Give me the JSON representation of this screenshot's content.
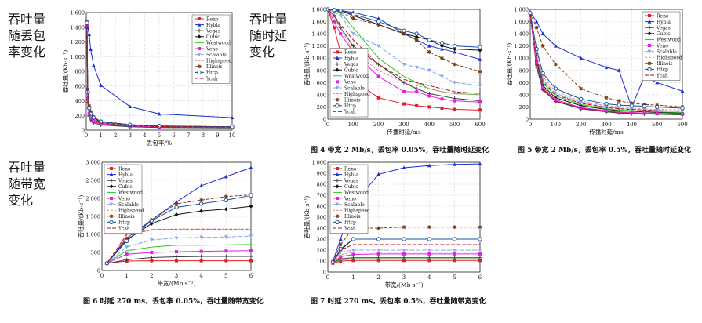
{
  "side_labels": [
    "吞吐量\n随丢包\n率变化",
    "吞吐量\n随时延\n变化",
    "吞吐量\n随带宽\n变化"
  ],
  "captions": {
    "fig4": "图 4  带宽 2 Mb/s，丢包率 0.05%，吞吐量随时延变化",
    "fig5": "图 5  带宽 2 Mb/s，丢包率 0.5%，吞吐量随时延变化",
    "fig6": "图 6  时延 270 ms，丢包率 0.05%，吞吐量随带宽变化",
    "fig7": "图 7  时延 270 ms，丢包率 0.5%，吞吐量随带宽变化"
  },
  "colors": {
    "Reno": "#e0202a",
    "Hybla": "#1c2fd6",
    "Vegas": "#3a3a3a",
    "Cubic": "#111111",
    "Westwood": "#22cc22",
    "Veno": "#e020e0",
    "Scalable": "#8aa7ee",
    "Highspeed": "#e08a8a",
    "Illinois": "#7a3a10",
    "Htcp": "#1a4fa0",
    "Ycah": "#b01010"
  },
  "chart_data": [
    {
      "type": "line",
      "xlabel": "丢包率/%",
      "ylabel": "吞吐量/(Kb·s⁻¹)",
      "x": [
        0.05,
        0.1,
        0.2,
        0.3,
        0.5,
        1,
        3,
        5,
        10
      ],
      "xticks": [
        "0",
        "1",
        "2",
        "3",
        "4",
        "5",
        "6",
        "7",
        "8",
        "9",
        "10"
      ],
      "yticks": [
        "0",
        "200",
        "400",
        "600",
        "800",
        "1 000",
        "1 200",
        "1 400",
        "1 600"
      ],
      "xlim": [
        0,
        10
      ],
      "ylim": [
        0,
        1600
      ],
      "legend": "top-right",
      "series": [
        {
          "name": "Reno",
          "values": [
            1400,
            420,
            210,
            160,
            120,
            80,
            50,
            40,
            35
          ]
        },
        {
          "name": "Hybla",
          "values": [
            1480,
            1400,
            1300,
            1100,
            880,
            610,
            320,
            220,
            170
          ]
        },
        {
          "name": "Vegas",
          "values": [
            1450,
            380,
            190,
            140,
            100,
            70,
            45,
            35,
            30
          ]
        },
        {
          "name": "Cubic",
          "values": [
            1460,
            520,
            300,
            220,
            160,
            110,
            70,
            55,
            45
          ]
        },
        {
          "name": "Westwood",
          "values": [
            1430,
            440,
            230,
            170,
            130,
            90,
            60,
            45,
            40
          ]
        },
        {
          "name": "Veno",
          "values": [
            1420,
            430,
            220,
            160,
            120,
            85,
            55,
            42,
            38
          ]
        },
        {
          "name": "Scalable",
          "values": [
            1440,
            480,
            260,
            200,
            150,
            100,
            65,
            50,
            42
          ]
        },
        {
          "name": "Highspeed",
          "values": [
            1450,
            500,
            280,
            210,
            160,
            105,
            70,
            52,
            44
          ]
        },
        {
          "name": "Illinois",
          "values": [
            1470,
            560,
            330,
            250,
            180,
            120,
            75,
            58,
            46
          ]
        },
        {
          "name": "Htcp",
          "values": [
            1460,
            520,
            300,
            220,
            170,
            115,
            72,
            56,
            45
          ]
        },
        {
          "name": "Ycah",
          "values": [
            1440,
            470,
            250,
            190,
            145,
            98,
            62,
            48,
            41
          ]
        }
      ]
    },
    {
      "type": "line",
      "xlabel": "传播时延/ms",
      "ylabel": "吞吐量/(Kb·s⁻¹)",
      "x": [
        0,
        25,
        50,
        100,
        200,
        300,
        350,
        400,
        450,
        500,
        600
      ],
      "xticks": [
        "0",
        "100",
        "200",
        "300",
        "400",
        "500",
        "600"
      ],
      "yticks": [
        "0",
        "200",
        "400",
        "600",
        "800",
        "1 000",
        "1 200",
        "1 400",
        "1 600",
        "1 800"
      ],
      "xlim": [
        0,
        600
      ],
      "ylim": [
        0,
        1800
      ],
      "legend": "bottom-left",
      "series": [
        {
          "name": "Reno",
          "values": [
            1800,
            1500,
            1100,
            650,
            350,
            250,
            220,
            200,
            180,
            160,
            150
          ]
        },
        {
          "name": "Hybla",
          "values": [
            1800,
            1790,
            1780,
            1750,
            1650,
            1400,
            1300,
            1200,
            1150,
            1100,
            980
          ]
        },
        {
          "name": "Vegas",
          "values": [
            1800,
            1700,
            1500,
            1200,
            900,
            600,
            500,
            420,
            380,
            340,
            300
          ]
        },
        {
          "name": "Cubic",
          "values": [
            1800,
            1790,
            1780,
            1700,
            1550,
            1400,
            1350,
            1300,
            1200,
            1150,
            1130
          ]
        },
        {
          "name": "Westwood",
          "values": [
            1800,
            1780,
            1750,
            1500,
            1000,
            700,
            600,
            500,
            450,
            420,
            400
          ]
        },
        {
          "name": "Veno",
          "values": [
            1800,
            1600,
            1400,
            1100,
            700,
            450,
            450,
            380,
            330,
            300,
            280
          ]
        },
        {
          "name": "Scalable",
          "values": [
            1800,
            1750,
            1700,
            1400,
            1200,
            900,
            850,
            800,
            700,
            600,
            550
          ]
        },
        {
          "name": "Highspeed",
          "values": [
            1800,
            1650,
            1500,
            1100,
            800,
            600,
            550,
            500,
            450,
            420,
            400
          ]
        },
        {
          "name": "Illinois",
          "values": [
            1800,
            1780,
            1760,
            1650,
            1550,
            1400,
            1300,
            1100,
            1000,
            900,
            780
          ]
        },
        {
          "name": "Htcp",
          "values": [
            1800,
            1790,
            1780,
            1720,
            1600,
            1450,
            1400,
            1300,
            1250,
            1200,
            1180
          ]
        },
        {
          "name": "Ycah",
          "values": [
            1800,
            1700,
            1550,
            1300,
            900,
            650,
            600,
            550,
            500,
            450,
            420
          ]
        }
      ]
    },
    {
      "type": "line",
      "xlabel": "传播时延/ms",
      "ylabel": "吞吐量/(Kb·s⁻¹)",
      "x": [
        0,
        25,
        50,
        100,
        200,
        300,
        350,
        400,
        450,
        500,
        600
      ],
      "xticks": [
        "0",
        "100",
        "200",
        "300",
        "400",
        "500",
        "600"
      ],
      "yticks": [
        "0",
        "200",
        "400",
        "600",
        "800",
        "1 000",
        "1 200",
        "1 400",
        "1 600",
        "1 800"
      ],
      "xlim": [
        0,
        600
      ],
      "ylim": [
        0,
        1800
      ],
      "legend": "top-right",
      "series": [
        {
          "name": "Reno",
          "values": [
            1700,
            900,
            500,
            300,
            180,
            130,
            110,
            100,
            95,
            90,
            80
          ]
        },
        {
          "name": "Hybla",
          "values": [
            1750,
            1600,
            1400,
            1200,
            1000,
            850,
            800,
            200,
            700,
            600,
            460
          ]
        },
        {
          "name": "Vegas",
          "values": [
            1720,
            850,
            480,
            290,
            170,
            120,
            100,
            90,
            85,
            80,
            70
          ]
        },
        {
          "name": "Cubic",
          "values": [
            1730,
            950,
            550,
            350,
            220,
            160,
            140,
            130,
            120,
            110,
            100
          ]
        },
        {
          "name": "Westwood",
          "values": [
            1710,
            1000,
            600,
            380,
            240,
            170,
            150,
            140,
            130,
            120,
            110
          ]
        },
        {
          "name": "Veno",
          "values": [
            1700,
            920,
            520,
            320,
            190,
            140,
            120,
            110,
            100,
            95,
            85
          ]
        },
        {
          "name": "Scalable",
          "values": [
            1720,
            1050,
            650,
            420,
            280,
            200,
            180,
            160,
            150,
            140,
            130
          ]
        },
        {
          "name": "Highspeed",
          "values": [
            1730,
            1100,
            700,
            450,
            300,
            220,
            200,
            180,
            170,
            160,
            150
          ]
        },
        {
          "name": "Illinois",
          "values": [
            1740,
            1500,
            1200,
            900,
            500,
            350,
            300,
            260,
            240,
            230,
            200
          ]
        },
        {
          "name": "Htcp",
          "values": [
            1740,
            1150,
            750,
            500,
            330,
            250,
            230,
            220,
            210,
            200,
            180
          ]
        },
        {
          "name": "Ycah",
          "values": [
            1720,
            1000,
            620,
            400,
            260,
            190,
            170,
            160,
            150,
            140,
            130
          ]
        }
      ]
    },
    {
      "type": "line",
      "xlabel": "带宽/(Mb·s⁻¹)",
      "ylabel": "吞吐量/(Kb·s⁻¹)",
      "x": [
        0.2,
        1,
        2,
        3,
        4,
        5,
        6
      ],
      "xticks": [
        "0",
        "1",
        "2",
        "3",
        "4",
        "5",
        "6"
      ],
      "yticks": [
        "0",
        "500",
        "1 000",
        "1 500",
        "2 000",
        "2 500",
        "3 000"
      ],
      "xlim": [
        0,
        6
      ],
      "ylim": [
        0,
        3000
      ],
      "legend": "top-left",
      "series": [
        {
          "name": "Reno",
          "values": [
            200,
            260,
            270,
            270,
            270,
            270,
            270
          ]
        },
        {
          "name": "Hybla",
          "values": [
            200,
            900,
            1400,
            1900,
            2350,
            2600,
            2850
          ]
        },
        {
          "name": "Vegas",
          "values": [
            190,
            300,
            360,
            380,
            390,
            390,
            390
          ]
        },
        {
          "name": "Cubic",
          "values": [
            200,
            850,
            1300,
            1550,
            1650,
            1700,
            1780
          ]
        },
        {
          "name": "Westwood",
          "values": [
            200,
            550,
            650,
            700,
            700,
            710,
            720
          ]
        },
        {
          "name": "Veno",
          "values": [
            200,
            450,
            500,
            520,
            530,
            540,
            550
          ]
        },
        {
          "name": "Scalable",
          "values": [
            200,
            650,
            850,
            900,
            920,
            930,
            950
          ]
        },
        {
          "name": "Highspeed",
          "values": [
            200,
            950,
            1130,
            1150,
            1150,
            1150,
            1150
          ]
        },
        {
          "name": "Illinois",
          "values": [
            200,
            850,
            1400,
            1850,
            1950,
            2050,
            2100
          ]
        },
        {
          "name": "Htcp",
          "values": [
            200,
            820,
            1380,
            1750,
            1850,
            1950,
            2080
          ]
        },
        {
          "name": "Ycah",
          "values": [
            200,
            1000,
            1130,
            1130,
            1130,
            1130,
            1130
          ]
        }
      ]
    },
    {
      "type": "line",
      "xlabel": "带宽/(Mb·s⁻¹)",
      "ylabel": "吞吐量/(Kb·s⁻¹)",
      "x": [
        0.2,
        0.5,
        1,
        2,
        3,
        4,
        5,
        6
      ],
      "xticks": [
        "0",
        "1",
        "2",
        "3",
        "4",
        "5",
        "6"
      ],
      "yticks": [
        "0",
        "100",
        "200",
        "300",
        "400",
        "500",
        "600",
        "700",
        "800",
        "900",
        "1 000"
      ],
      "xlim": [
        0,
        6
      ],
      "ylim": [
        0,
        1000
      ],
      "legend": "top-left",
      "series": [
        {
          "name": "Reno",
          "values": [
            80,
            100,
            105,
            105,
            105,
            105,
            105,
            105
          ]
        },
        {
          "name": "Hybla",
          "values": [
            100,
            300,
            620,
            890,
            950,
            970,
            980,
            985
          ]
        },
        {
          "name": "Vegas",
          "values": [
            85,
            120,
            130,
            130,
            130,
            130,
            130,
            130
          ]
        },
        {
          "name": "Cubic",
          "values": [
            90,
            200,
            300,
            300,
            300,
            300,
            300,
            300
          ]
        },
        {
          "name": "Westwood",
          "values": [
            85,
            110,
            120,
            120,
            120,
            120,
            120,
            120
          ]
        },
        {
          "name": "Veno",
          "values": [
            85,
            140,
            160,
            165,
            165,
            165,
            165,
            165
          ]
        },
        {
          "name": "Scalable",
          "values": [
            90,
            180,
            200,
            200,
            200,
            200,
            200,
            200
          ]
        },
        {
          "name": "Highspeed",
          "values": [
            90,
            160,
            180,
            180,
            180,
            180,
            180,
            180
          ]
        },
        {
          "name": "Illinois",
          "values": [
            95,
            250,
            400,
            400,
            410,
            410,
            410,
            410
          ]
        },
        {
          "name": "Htcp",
          "values": [
            90,
            210,
            300,
            300,
            300,
            300,
            300,
            300
          ]
        },
        {
          "name": "Ycah",
          "values": [
            88,
            200,
            250,
            250,
            250,
            250,
            250,
            250
          ]
        }
      ]
    }
  ]
}
